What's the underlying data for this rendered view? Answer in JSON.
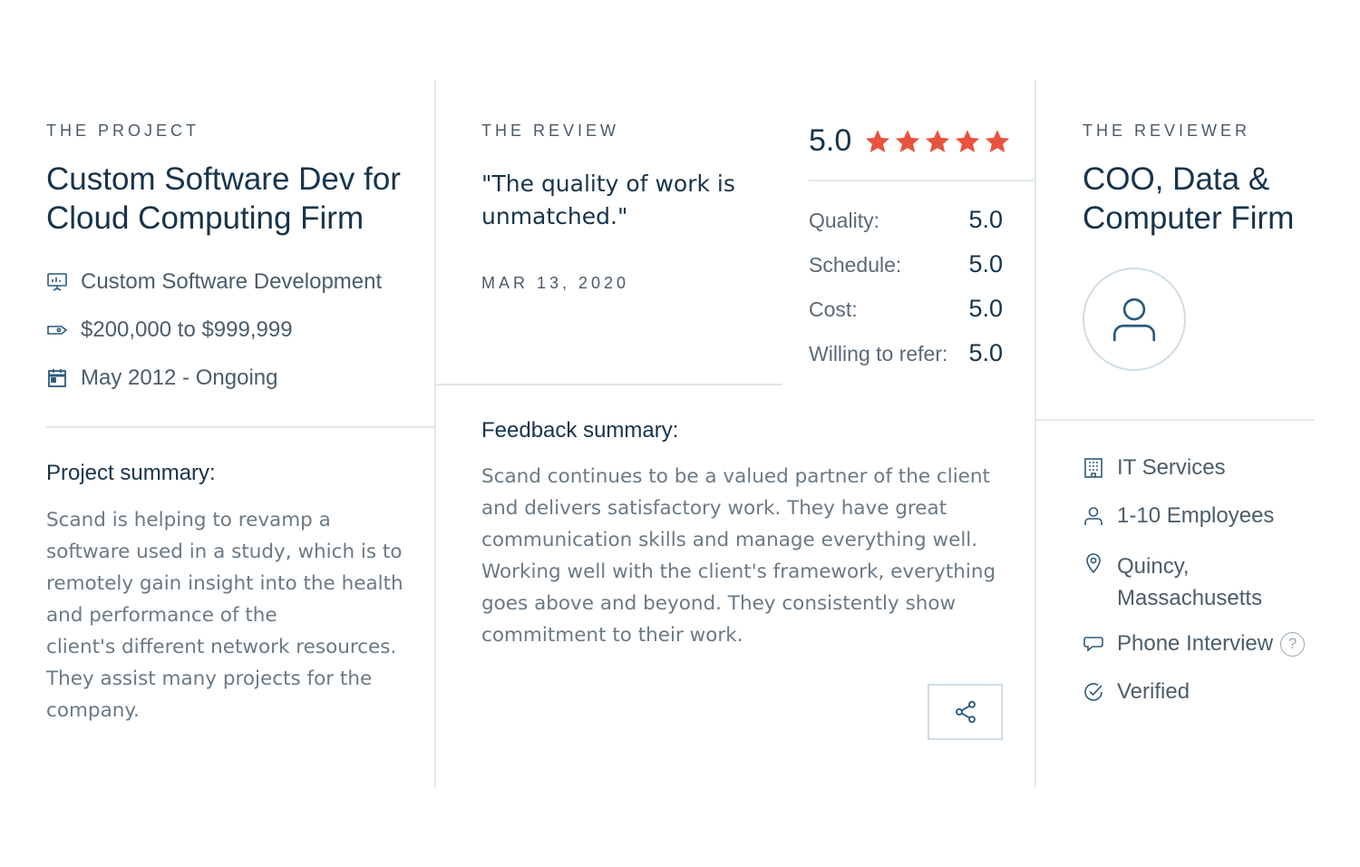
{
  "project": {
    "eyebrow": "THE PROJECT",
    "title_line1": "Custom Software Dev for",
    "title_line2": "Cloud Computing Firm",
    "service": "Custom Software Development",
    "budget": "$200,000 to $999,999",
    "dates": "May 2012 - Ongoing",
    "summary_heading": "Project summary:",
    "summary_lines": [
      "Scand is helping to revamp a",
      "software used in a study, which is to",
      "remotely gain insight into the health",
      "and performance of the",
      "client's different network resources.",
      "They assist many projects for the",
      "company."
    ]
  },
  "review": {
    "eyebrow": "THE REVIEW",
    "quote_line1": "\"The quality of work is",
    "quote_line2": "unmatched.\"",
    "date": "MAR 13, 2020",
    "overall_score": "5.0",
    "star_count": 5,
    "scores": [
      {
        "label": "Quality:",
        "value": "5.0"
      },
      {
        "label": "Schedule:",
        "value": "5.0"
      },
      {
        "label": "Cost:",
        "value": "5.0"
      },
      {
        "label": "Willing to refer:",
        "value": "5.0"
      }
    ],
    "feedback_heading": "Feedback summary:",
    "feedback_lines": [
      "Scand continues to be a valued partner of the client",
      "and delivers satisfactory work. They have great",
      "communication skills and manage everything well.",
      "Working well with the client's framework, everything",
      "goes above and beyond. They consistently show",
      "commitment to their work."
    ]
  },
  "reviewer": {
    "eyebrow": "THE REVIEWER",
    "title_line1": "COO, Data &",
    "title_line2": "Computer Firm",
    "industry": "IT Services",
    "size": "1-10 Employees",
    "location_line1": "Quincy,",
    "location_line2": "Massachusetts",
    "interview_type": "Phone Interview",
    "help_glyph": "?",
    "status": "Verified"
  },
  "colors": {
    "star": "#e8533f",
    "icon": "#2b5a7a",
    "divider": "#e1e8ee"
  }
}
